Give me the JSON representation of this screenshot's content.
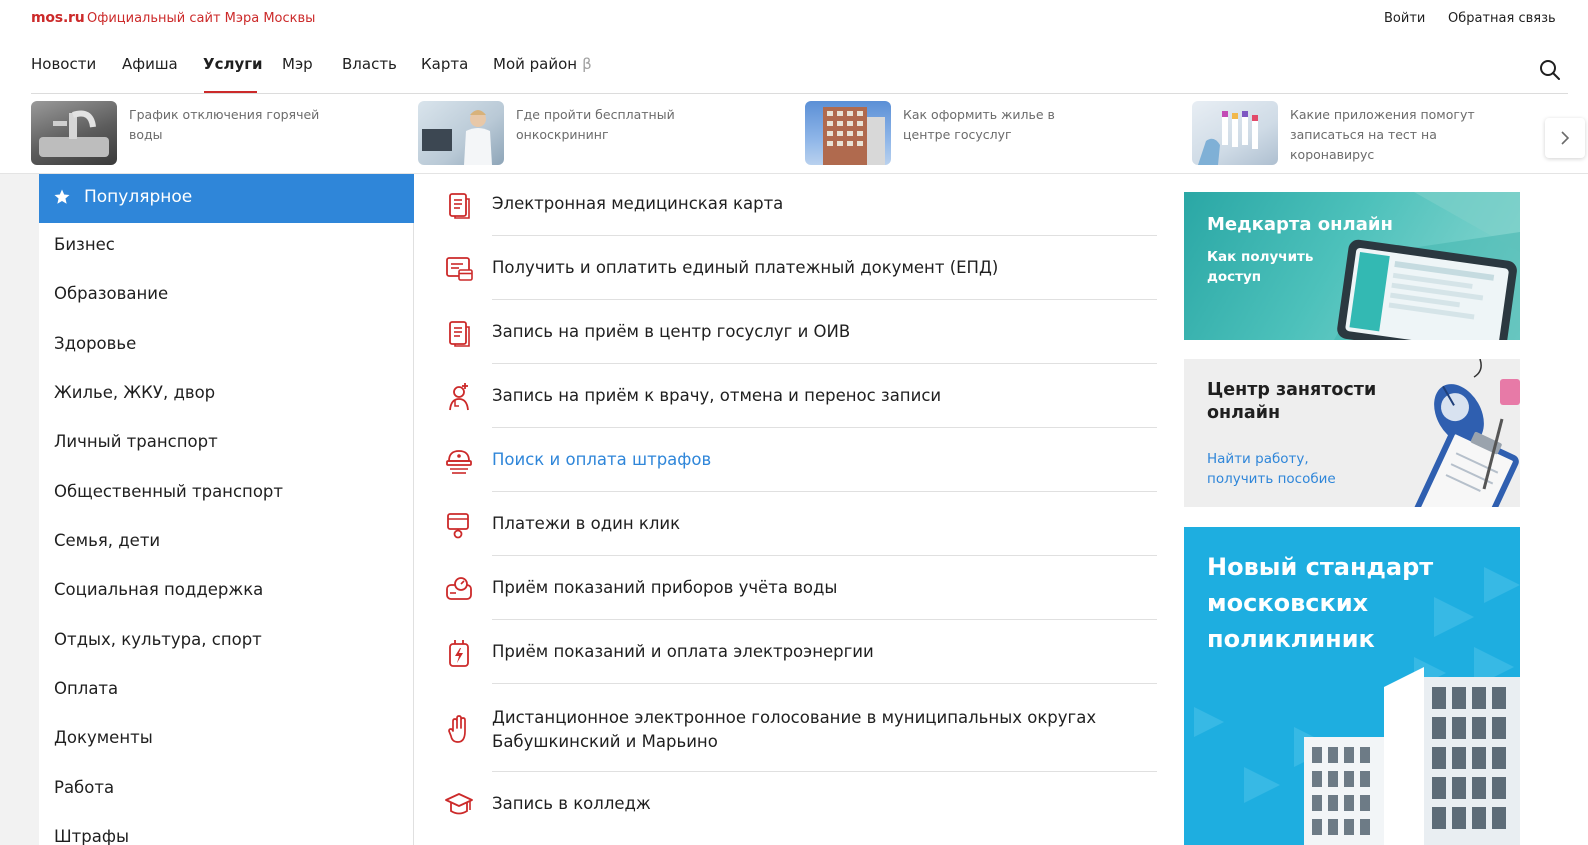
{
  "header": {
    "brand": "mos.ru",
    "brand_subtitle": "Официальный сайт Мэра Москвы",
    "login": "Войти",
    "feedback": "Обратная связь"
  },
  "nav": {
    "items": [
      "Новости",
      "Афиша",
      "Услуги",
      "Мэр",
      "Власть",
      "Карта",
      "Мой район"
    ],
    "active": "Услуги",
    "beta_mark": "β"
  },
  "news": [
    {
      "text": "График отключения горячей воды",
      "icon": "faucet-photo"
    },
    {
      "text": "Где пройти бесплатный онкоскрининг",
      "icon": "doctor-photo"
    },
    {
      "text": "Как оформить жилье в центре госуслуг",
      "icon": "building-photo"
    },
    {
      "text": "Какие приложения помогут записаться на тест на коронавирус",
      "icon": "test-tubes-photo"
    }
  ],
  "sidebar": {
    "active": "Популярное",
    "items": [
      "Бизнес",
      "Образование",
      "Здоровье",
      "Жилье, ЖКУ, двор",
      "Личный транспорт",
      "Общественный транспорт",
      "Семья, дети",
      "Социальная поддержка",
      "Отдых, культура, спорт",
      "Оплата",
      "Документы",
      "Работа",
      "Штрафы"
    ]
  },
  "services": [
    {
      "label": "Электронная медицинская карта",
      "icon": "document-icon"
    },
    {
      "label": "Получить и оплатить единый платежный документ (ЕПД)",
      "icon": "payment-document-icon"
    },
    {
      "label": "Запись на приём в центр госуслуг и ОИВ",
      "icon": "document-icon"
    },
    {
      "label": "Запись на приём к врачу, отмена и перенос записи",
      "icon": "doctor-icon"
    },
    {
      "label": "Поиск и оплата штрафов",
      "icon": "police-cap-icon"
    },
    {
      "label": "Платежи в один клик",
      "icon": "card-click-icon"
    },
    {
      "label": "Приём показаний приборов учёта воды",
      "icon": "water-meter-icon"
    },
    {
      "label": "Приём показаний и оплата электроэнергии",
      "icon": "electricity-icon"
    },
    {
      "label": "Дистанционное электронное голосование в муниципальных округах",
      "label2": "Бабушкинский и Марьино",
      "icon": "hand-icon"
    },
    {
      "label": "Запись в колледж",
      "icon": "graduation-cap-icon"
    }
  ],
  "banners": {
    "medcard_title": "Медкарта онлайн",
    "medcard_subtitle": "Как получить доступ",
    "jobs_title": "Центр занятости онлайн",
    "jobs_subtitle": "Найти работу, получить пособие",
    "clinic_title": "Новый стандарт московских поликлиник"
  },
  "colors": {
    "brand_red": "#cc2a2a",
    "accent_blue": "#2f86d9",
    "icon_red": "#cc2a2a"
  }
}
